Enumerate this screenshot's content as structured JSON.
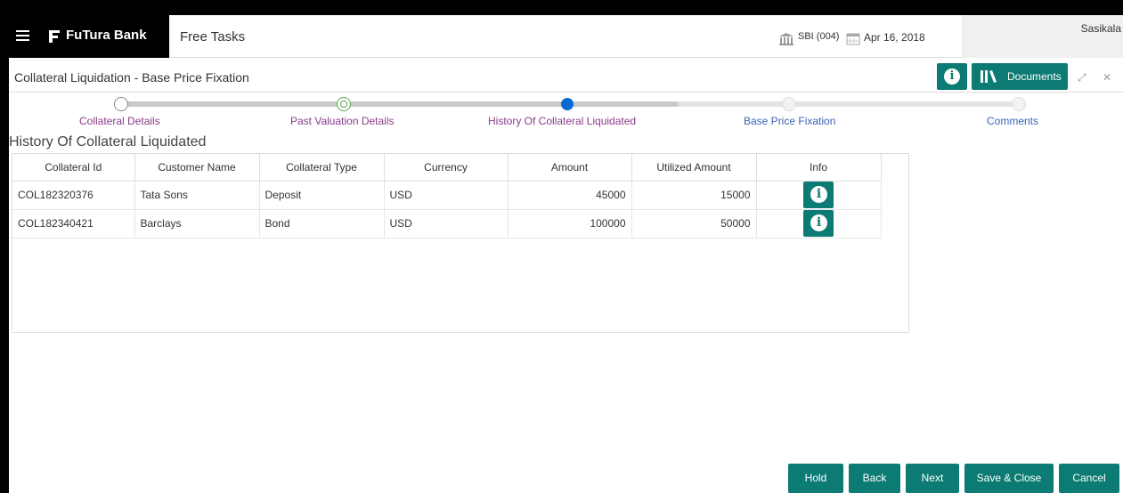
{
  "header": {
    "brand": "FuTura Bank",
    "menu_title": "Free Tasks",
    "branch": "SBI (004)",
    "date": "Apr 16, 2018",
    "user": "Sasikala"
  },
  "page": {
    "title": "Collateral Liquidation - Base Price Fixation",
    "documents_label": "Documents"
  },
  "train": {
    "steps": [
      {
        "label": "Collateral Details",
        "state": "done"
      },
      {
        "label": "Past Valuation Details",
        "state": "visited"
      },
      {
        "label": "History Of Collateral Liquidated",
        "state": "current"
      },
      {
        "label": "Base Price Fixation",
        "state": "todo"
      },
      {
        "label": "Comments",
        "state": "todo"
      }
    ]
  },
  "section": {
    "title": "History Of Collateral Liquidated"
  },
  "table": {
    "columns": [
      "Collateral Id",
      "Customer Name",
      "Collateral Type",
      "Currency",
      "Amount",
      "Utilized Amount",
      "Info"
    ],
    "rows": [
      {
        "collateral_id": "COL182320376",
        "customer_name": "Tata Sons",
        "collateral_type": "Deposit",
        "currency": "USD",
        "amount": "45000",
        "utilized_amount": "15000"
      },
      {
        "collateral_id": "COL182340421",
        "customer_name": "Barclays",
        "collateral_type": "Bond",
        "currency": "USD",
        "amount": "100000",
        "utilized_amount": "50000"
      }
    ]
  },
  "footer": {
    "hold": "Hold",
    "back": "Back",
    "next": "Next",
    "save_close": "Save & Close",
    "cancel": "Cancel"
  },
  "colors": {
    "accent": "#0b7b73",
    "current_step": "#0a6ad4",
    "done_label": "#8a3c8a",
    "todo_label": "#3a63b5"
  }
}
